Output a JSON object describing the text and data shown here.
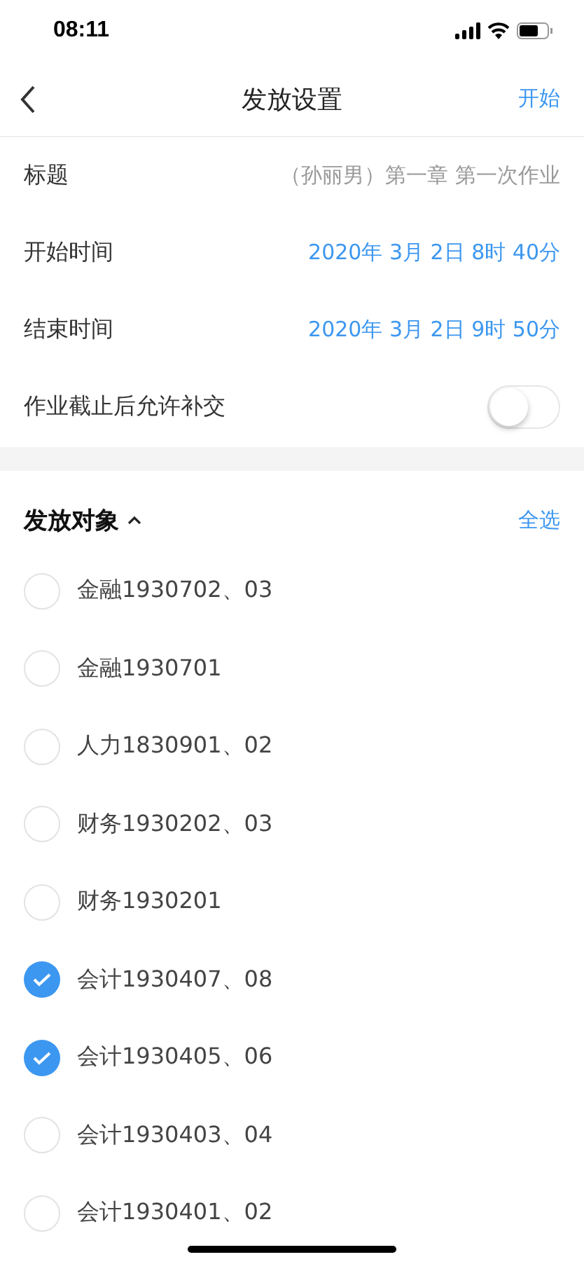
{
  "status_bar": {
    "time": "08:11"
  },
  "nav": {
    "title": "发放设置",
    "action": "开始"
  },
  "fields": [
    {
      "kind": "text",
      "label": "标题",
      "value": "（孙丽男）第一章 第一次作业"
    },
    {
      "kind": "time",
      "label": "开始时间",
      "value": "2020年 3月 2日 8时 40分"
    },
    {
      "kind": "time",
      "label": "结束时间",
      "value": "2020年 3月 2日 9时 50分"
    },
    {
      "kind": "switch",
      "label": "作业截止后允许补交",
      "on": false
    }
  ],
  "targets": {
    "title": "发放对象",
    "expanded": true,
    "select_all": "全选",
    "items": [
      {
        "label": "金融1930702、03",
        "selected": false
      },
      {
        "label": "金融1930701",
        "selected": false
      },
      {
        "label": "人力1830901、02",
        "selected": false
      },
      {
        "label": "财务1930202、03",
        "selected": false
      },
      {
        "label": "财务1930201",
        "selected": false
      },
      {
        "label": "会计1930407、08",
        "selected": true
      },
      {
        "label": "会计1930405、06",
        "selected": true
      },
      {
        "label": "会计1930403、04",
        "selected": false
      },
      {
        "label": "会计1930401、02",
        "selected": false
      }
    ]
  }
}
